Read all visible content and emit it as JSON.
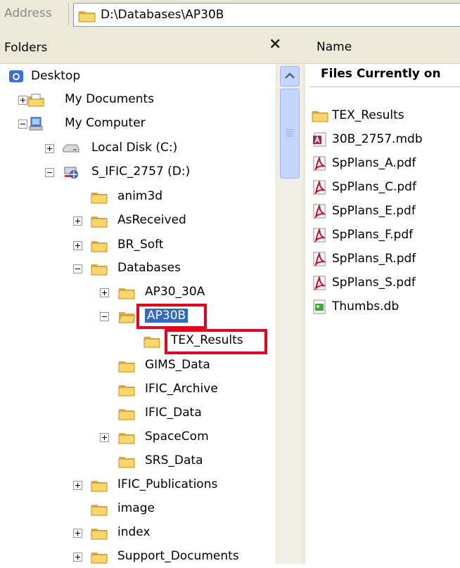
{
  "address": {
    "label": "Address",
    "path": "D:\\Databases\\AP30B"
  },
  "folders_pane": {
    "title": "Folders",
    "close_glyph": "×"
  },
  "tree": [
    {
      "label": "Desktop",
      "icon": "desktop-icon",
      "expander": "none"
    },
    {
      "label": "My Documents",
      "icon": "my-documents-icon",
      "expander": "plus"
    },
    {
      "label": "My Computer",
      "icon": "my-computer-icon",
      "expander": "minus"
    },
    {
      "label": "Local Disk (C:)",
      "icon": "local-disk-icon",
      "expander": "plus"
    },
    {
      "label": "S_IFIC_2757 (D:)",
      "icon": "network-drive-icon",
      "expander": "minus"
    },
    {
      "label": "anim3d",
      "icon": "folder-icon",
      "expander": "none"
    },
    {
      "label": "AsReceived",
      "icon": "folder-icon",
      "expander": "plus"
    },
    {
      "label": "BR_Soft",
      "icon": "folder-icon",
      "expander": "plus"
    },
    {
      "label": "Databases",
      "icon": "folder-icon",
      "expander": "minus"
    },
    {
      "label": "AP30_30A",
      "icon": "folder-icon",
      "expander": "plus"
    },
    {
      "label": "AP30B",
      "icon": "folder-open-icon",
      "expander": "minus",
      "selected": true
    },
    {
      "label": "TEX_Results",
      "icon": "folder-icon",
      "expander": "none"
    },
    {
      "label": "GIMS_Data",
      "icon": "folder-icon",
      "expander": "none"
    },
    {
      "label": "IFIC_Archive",
      "icon": "folder-icon",
      "expander": "none"
    },
    {
      "label": "IFIC_Data",
      "icon": "folder-icon",
      "expander": "none"
    },
    {
      "label": "SpaceCom",
      "icon": "folder-icon",
      "expander": "plus"
    },
    {
      "label": "SRS_Data",
      "icon": "folder-icon",
      "expander": "none"
    },
    {
      "label": "IFIC_Publications",
      "icon": "folder-icon",
      "expander": "plus"
    },
    {
      "label": "image",
      "icon": "folder-icon",
      "expander": "none"
    },
    {
      "label": "index",
      "icon": "folder-icon",
      "expander": "plus"
    },
    {
      "label": "Support_Documents",
      "icon": "folder-icon",
      "expander": "plus"
    }
  ],
  "files_pane": {
    "column_name": "Name",
    "heading": "Files Currently on",
    "files": [
      {
        "label": "TEX_Results",
        "icon": "folder-icon"
      },
      {
        "label": "30B_2757.mdb",
        "icon": "access-db-icon"
      },
      {
        "label": "SpPlans_A.pdf",
        "icon": "pdf-icon"
      },
      {
        "label": "SpPlans_C.pdf",
        "icon": "pdf-icon"
      },
      {
        "label": "SpPlans_E.pdf",
        "icon": "pdf-icon"
      },
      {
        "label": "SpPlans_F.pdf",
        "icon": "pdf-icon"
      },
      {
        "label": "SpPlans_R.pdf",
        "icon": "pdf-icon"
      },
      {
        "label": "SpPlans_S.pdf",
        "icon": "pdf-icon"
      },
      {
        "label": "Thumbs.db",
        "icon": "thumbs-db-icon"
      }
    ]
  },
  "colors": {
    "selection": "#316ac5",
    "highlight_box": "#e8001c",
    "folder": "#f2c14e"
  }
}
